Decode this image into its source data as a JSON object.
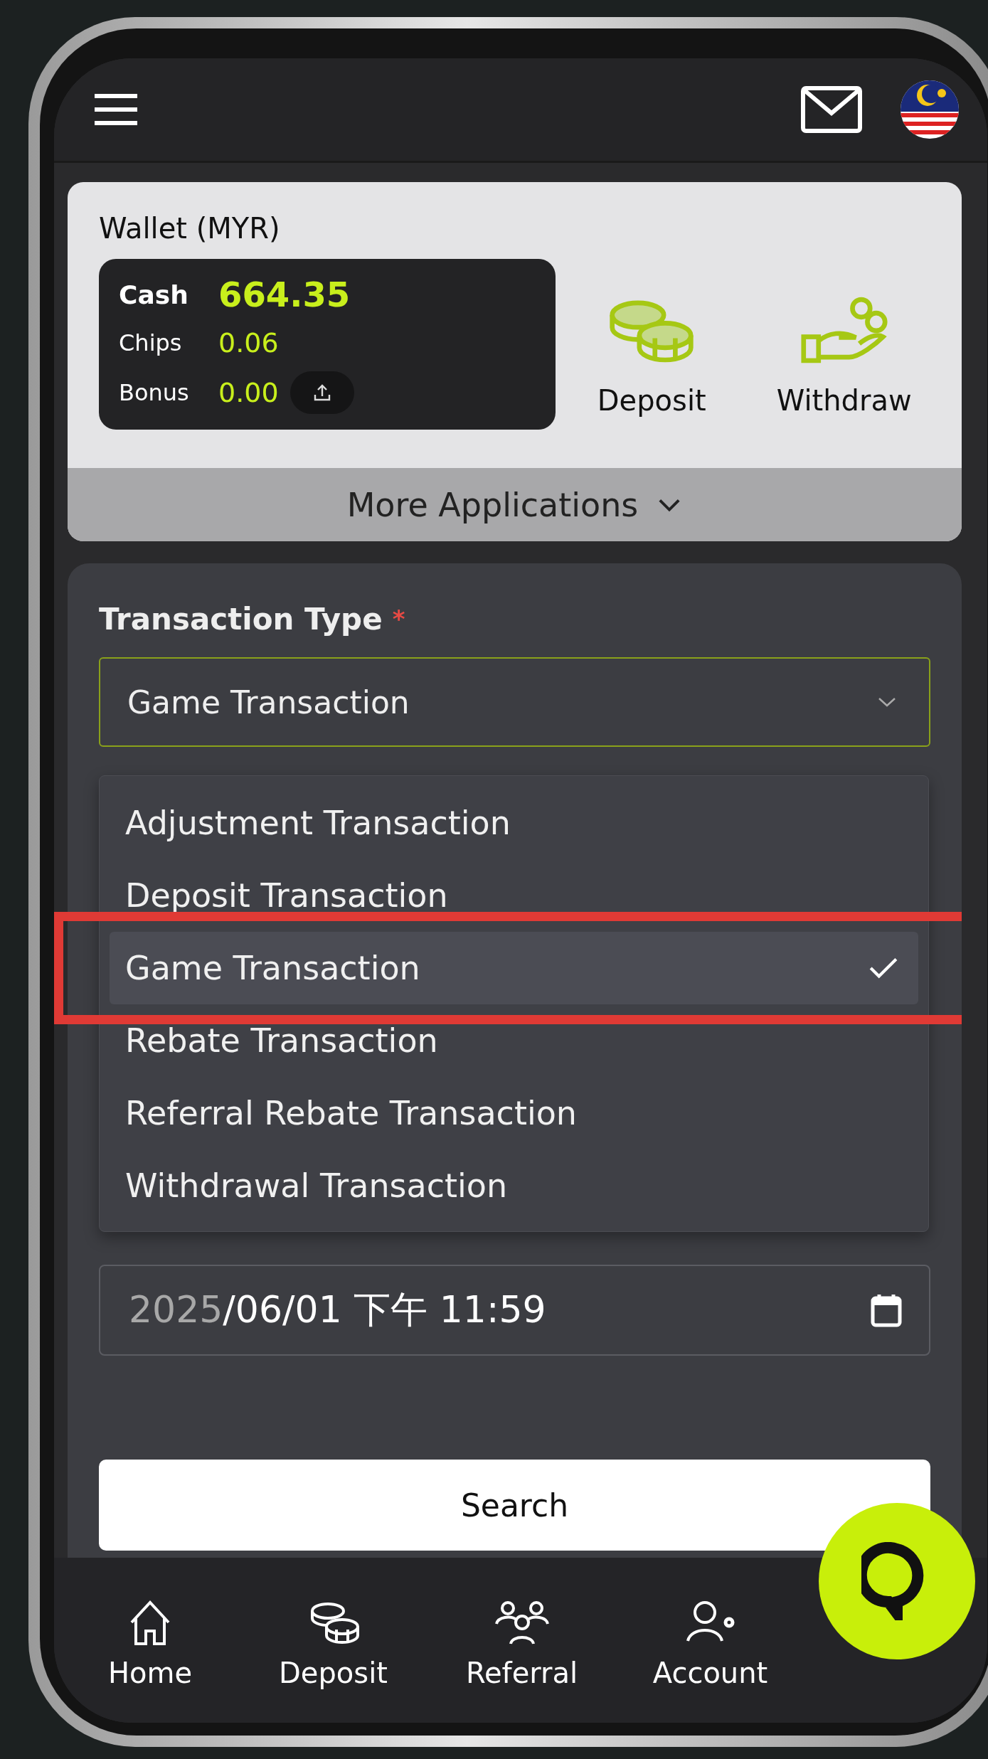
{
  "wallet": {
    "title": "Wallet (MYR)",
    "balances": [
      {
        "kind": "main",
        "label": "Cash",
        "value": "664.35"
      },
      {
        "kind": "minor",
        "label": "Chips",
        "value": "0.06"
      },
      {
        "kind": "upload",
        "label": "Bonus",
        "value": "0.00"
      }
    ],
    "actions": [
      {
        "kind": "coins",
        "label": "Deposit"
      },
      {
        "kind": "hand",
        "label": "Withdraw"
      }
    ],
    "more": "More Applications"
  },
  "form": {
    "label": "Transaction Type",
    "required_mark": "*",
    "select_value": "Game Transaction",
    "options": [
      {
        "label": "Adjustment Transaction",
        "selected": false
      },
      {
        "label": "Deposit Transaction",
        "selected": false
      },
      {
        "label": "Game Transaction",
        "selected": true
      },
      {
        "label": "Rebate Transaction",
        "selected": false
      },
      {
        "label": "Referral Rebate Transaction",
        "selected": false
      },
      {
        "label": "Withdrawal Transaction",
        "selected": false
      }
    ],
    "end_date": {
      "year": "2025",
      "rest": "/06/01 下午 11:59"
    },
    "search": "Search"
  },
  "nav": [
    {
      "kind": "home",
      "label": "Home"
    },
    {
      "kind": "coins",
      "label": "Deposit"
    },
    {
      "kind": "people",
      "label": "Referral"
    },
    {
      "kind": "account",
      "label": "Account"
    }
  ]
}
